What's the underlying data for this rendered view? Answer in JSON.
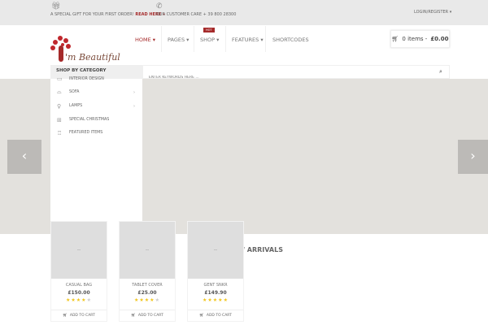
{
  "topbar": {
    "promo_text": "A SPECIAL GIFT FOR YOUR FIRST ORDER!",
    "promo_link": "READ HERE »",
    "care": "OUR CUSTOMER CARE + 39 800 28300",
    "login": "LOGIN/REGISTER"
  },
  "logo": {
    "text": "I'm Beautiful"
  },
  "nav": {
    "items": [
      {
        "label": "HOME"
      },
      {
        "label": "PAGES"
      },
      {
        "label": "SHOP"
      },
      {
        "label": "FEATURES"
      },
      {
        "label": "SHORTCODES"
      }
    ],
    "hot_badge": "HOT"
  },
  "cart": {
    "items": "0 items -",
    "total": "£0.00"
  },
  "category": {
    "title": "SHOP BY CATEGORY",
    "items": [
      {
        "label": "INTERIOR DESIGN"
      },
      {
        "label": "SOFA"
      },
      {
        "label": "LAMPS"
      },
      {
        "label": "SPECIAL CHRISTMAS"
      },
      {
        "label": "FEATURED ITEMS"
      }
    ]
  },
  "search": {
    "placeholder": "ENTER KEYWORDS HERE ..."
  },
  "section_title": "NEW ARRIVALS",
  "products": [
    {
      "name": "CASUAL BAG",
      "price": "£150.00",
      "rating": 4,
      "cta": "ADD TO CART",
      "placeholder": "--"
    },
    {
      "name": "TABLET COVER",
      "price": "£25.00",
      "rating": 4,
      "cta": "ADD TO CART",
      "placeholder": "--"
    },
    {
      "name": "GENT SNKR",
      "price": "£149.90",
      "rating": 5,
      "cta": "ADD TO CART",
      "placeholder": "--"
    }
  ],
  "colors": {
    "accent": "#a52a2a",
    "star": "#f0c419"
  }
}
